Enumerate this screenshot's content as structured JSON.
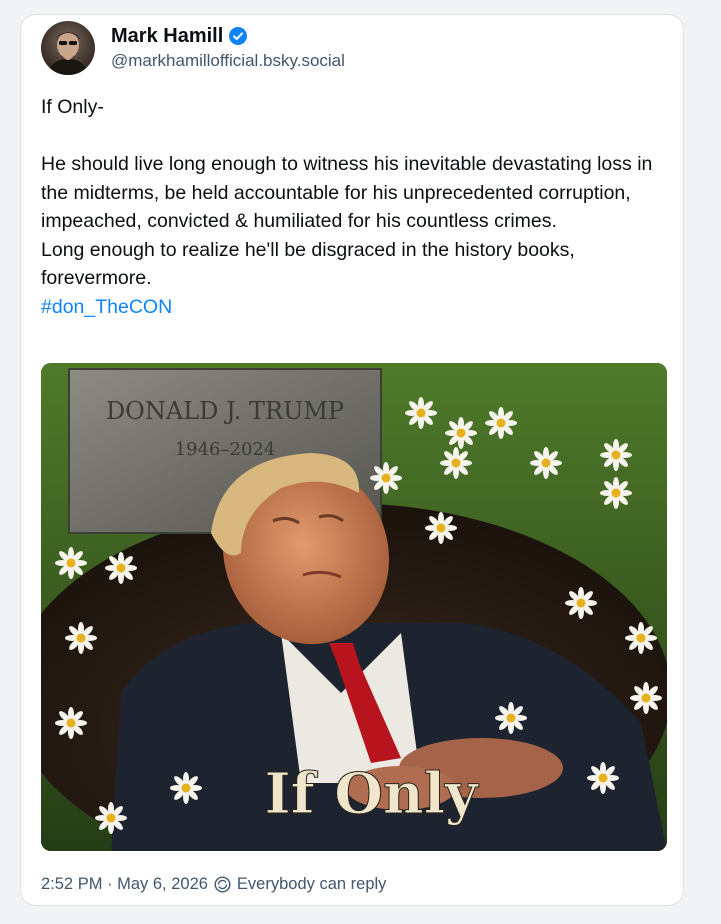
{
  "post": {
    "author": {
      "display_name": "Mark Hamill",
      "handle": "@markhamillofficial.bsky.social",
      "verified": true
    },
    "text": {
      "line1": "If Only-",
      "paragraph": "He should live long enough to witness his inevitable devastating loss in the midterms, be held accountable for his unprecedented corruption, impeached, convicted & humiliated for his countless crimes.",
      "paragraph2": "Long enough to realize he'll be disgraced in the history books, forevermore.",
      "hashtag": "#don_TheCON"
    },
    "image": {
      "headstone_name": "DONALD J. TRUMP",
      "headstone_dates": "1946–2024",
      "caption": "If Only"
    },
    "footer": {
      "timestamp": "2:52 PM · May 6, 2026",
      "reply_setting": "Everybody can reply"
    }
  },
  "colors": {
    "link": "#1083fe",
    "verified": "#1083fe",
    "muted": "#42576c"
  }
}
